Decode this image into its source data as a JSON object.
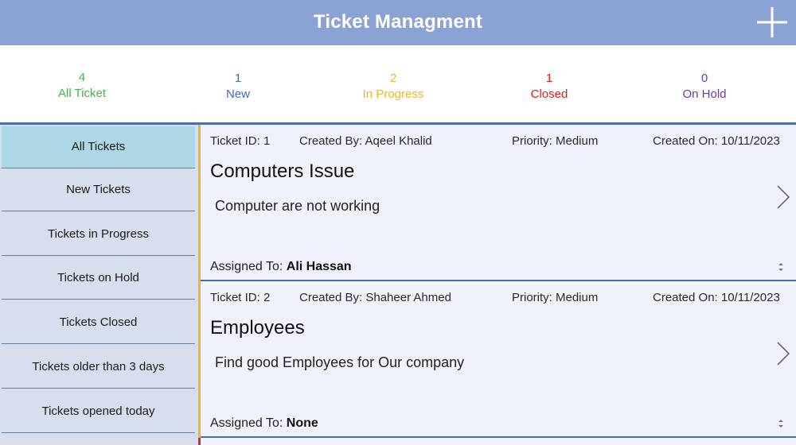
{
  "header": {
    "title": "Ticket Managment",
    "add_icon": "plus-icon"
  },
  "stats": [
    {
      "count": "4",
      "label": "All Ticket",
      "color": "#4caf50"
    },
    {
      "count": "1",
      "label": "New",
      "color": "#3d6cb8"
    },
    {
      "count": "2",
      "label": "In Progress",
      "color": "#f2b526"
    },
    {
      "count": "1",
      "label": "Closed",
      "color": "#e01b1b"
    },
    {
      "count": "0",
      "label": "On Hold",
      "color": "#6a3aa0"
    }
  ],
  "sidebar": {
    "items": [
      {
        "label": "All Tickets",
        "active": true
      },
      {
        "label": "New Tickets"
      },
      {
        "label": "Tickets in Progress"
      },
      {
        "label": "Tickets on Hold"
      },
      {
        "label": "Tickets Closed"
      },
      {
        "label": "Tickets older than 3 days"
      },
      {
        "label": "Tickets opened today"
      }
    ]
  },
  "tickets": [
    {
      "id": "Ticket ID: 1",
      "created_by": "Created By: Aqeel Khalid",
      "priority": "Priority: Medium",
      "created_on": "Created On: 10/11/2023",
      "title": "Computers Issue",
      "description": "Computer are not working",
      "assigned_label": "Assigned To: ",
      "assigned_to": "Ali Hassan"
    },
    {
      "id": "Ticket ID: 2",
      "created_by": "Created By: Shaheer Ahmed",
      "priority": "Priority: Medium",
      "created_on": "Created On: 10/11/2023",
      "title": "Employees",
      "description": "Find good Employees for Our company",
      "assigned_label": "Assigned To: ",
      "assigned_to": "None"
    }
  ],
  "colors": {
    "header": "#8aa2d4",
    "accent": "#4a6db2",
    "sidebar": "#d9deee",
    "sidebar_active": "#acd7e4",
    "sidebar_edge": "#f0b62b"
  }
}
